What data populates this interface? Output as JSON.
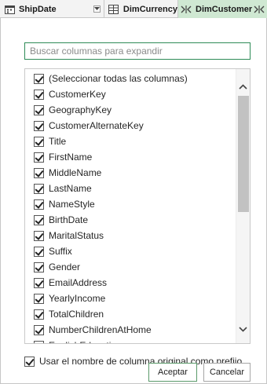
{
  "header": {
    "columns": [
      {
        "label": "ShipDate",
        "icon": "calendar-icon"
      },
      {
        "label": "DimCurrency",
        "icon": "table-icon"
      },
      {
        "label": "DimCustomer",
        "icon": "table-icon",
        "highlight": "#cfe8d2"
      }
    ],
    "expand_icon": "expand-columns-icon"
  },
  "search": {
    "placeholder": "Buscar columnas para expandir"
  },
  "list": {
    "items": [
      {
        "label": "(Seleccionar todas las columnas)",
        "checked": true
      },
      {
        "label": "CustomerKey",
        "checked": true
      },
      {
        "label": "GeographyKey",
        "checked": true
      },
      {
        "label": "CustomerAlternateKey",
        "checked": true
      },
      {
        "label": "Title",
        "checked": true
      },
      {
        "label": "FirstName",
        "checked": true
      },
      {
        "label": "MiddleName",
        "checked": true
      },
      {
        "label": "LastName",
        "checked": true
      },
      {
        "label": "NameStyle",
        "checked": true
      },
      {
        "label": "BirthDate",
        "checked": true
      },
      {
        "label": "MaritalStatus",
        "checked": true
      },
      {
        "label": "Suffix",
        "checked": true
      },
      {
        "label": "Gender",
        "checked": true
      },
      {
        "label": "EmailAddress",
        "checked": true
      },
      {
        "label": "YearlyIncome",
        "checked": true
      },
      {
        "label": "TotalChildren",
        "checked": true
      },
      {
        "label": "NumberChildrenAtHome",
        "checked": true
      },
      {
        "label": "EnglishEducation",
        "checked": true
      }
    ]
  },
  "prefix": {
    "label": "Usar el nombre de columna original como prefijo",
    "checked": true
  },
  "buttons": {
    "accept": "Aceptar",
    "cancel": "Cancelar"
  },
  "colors": {
    "accent": "#2e8b57",
    "selected_header": "#cfe8d2"
  }
}
